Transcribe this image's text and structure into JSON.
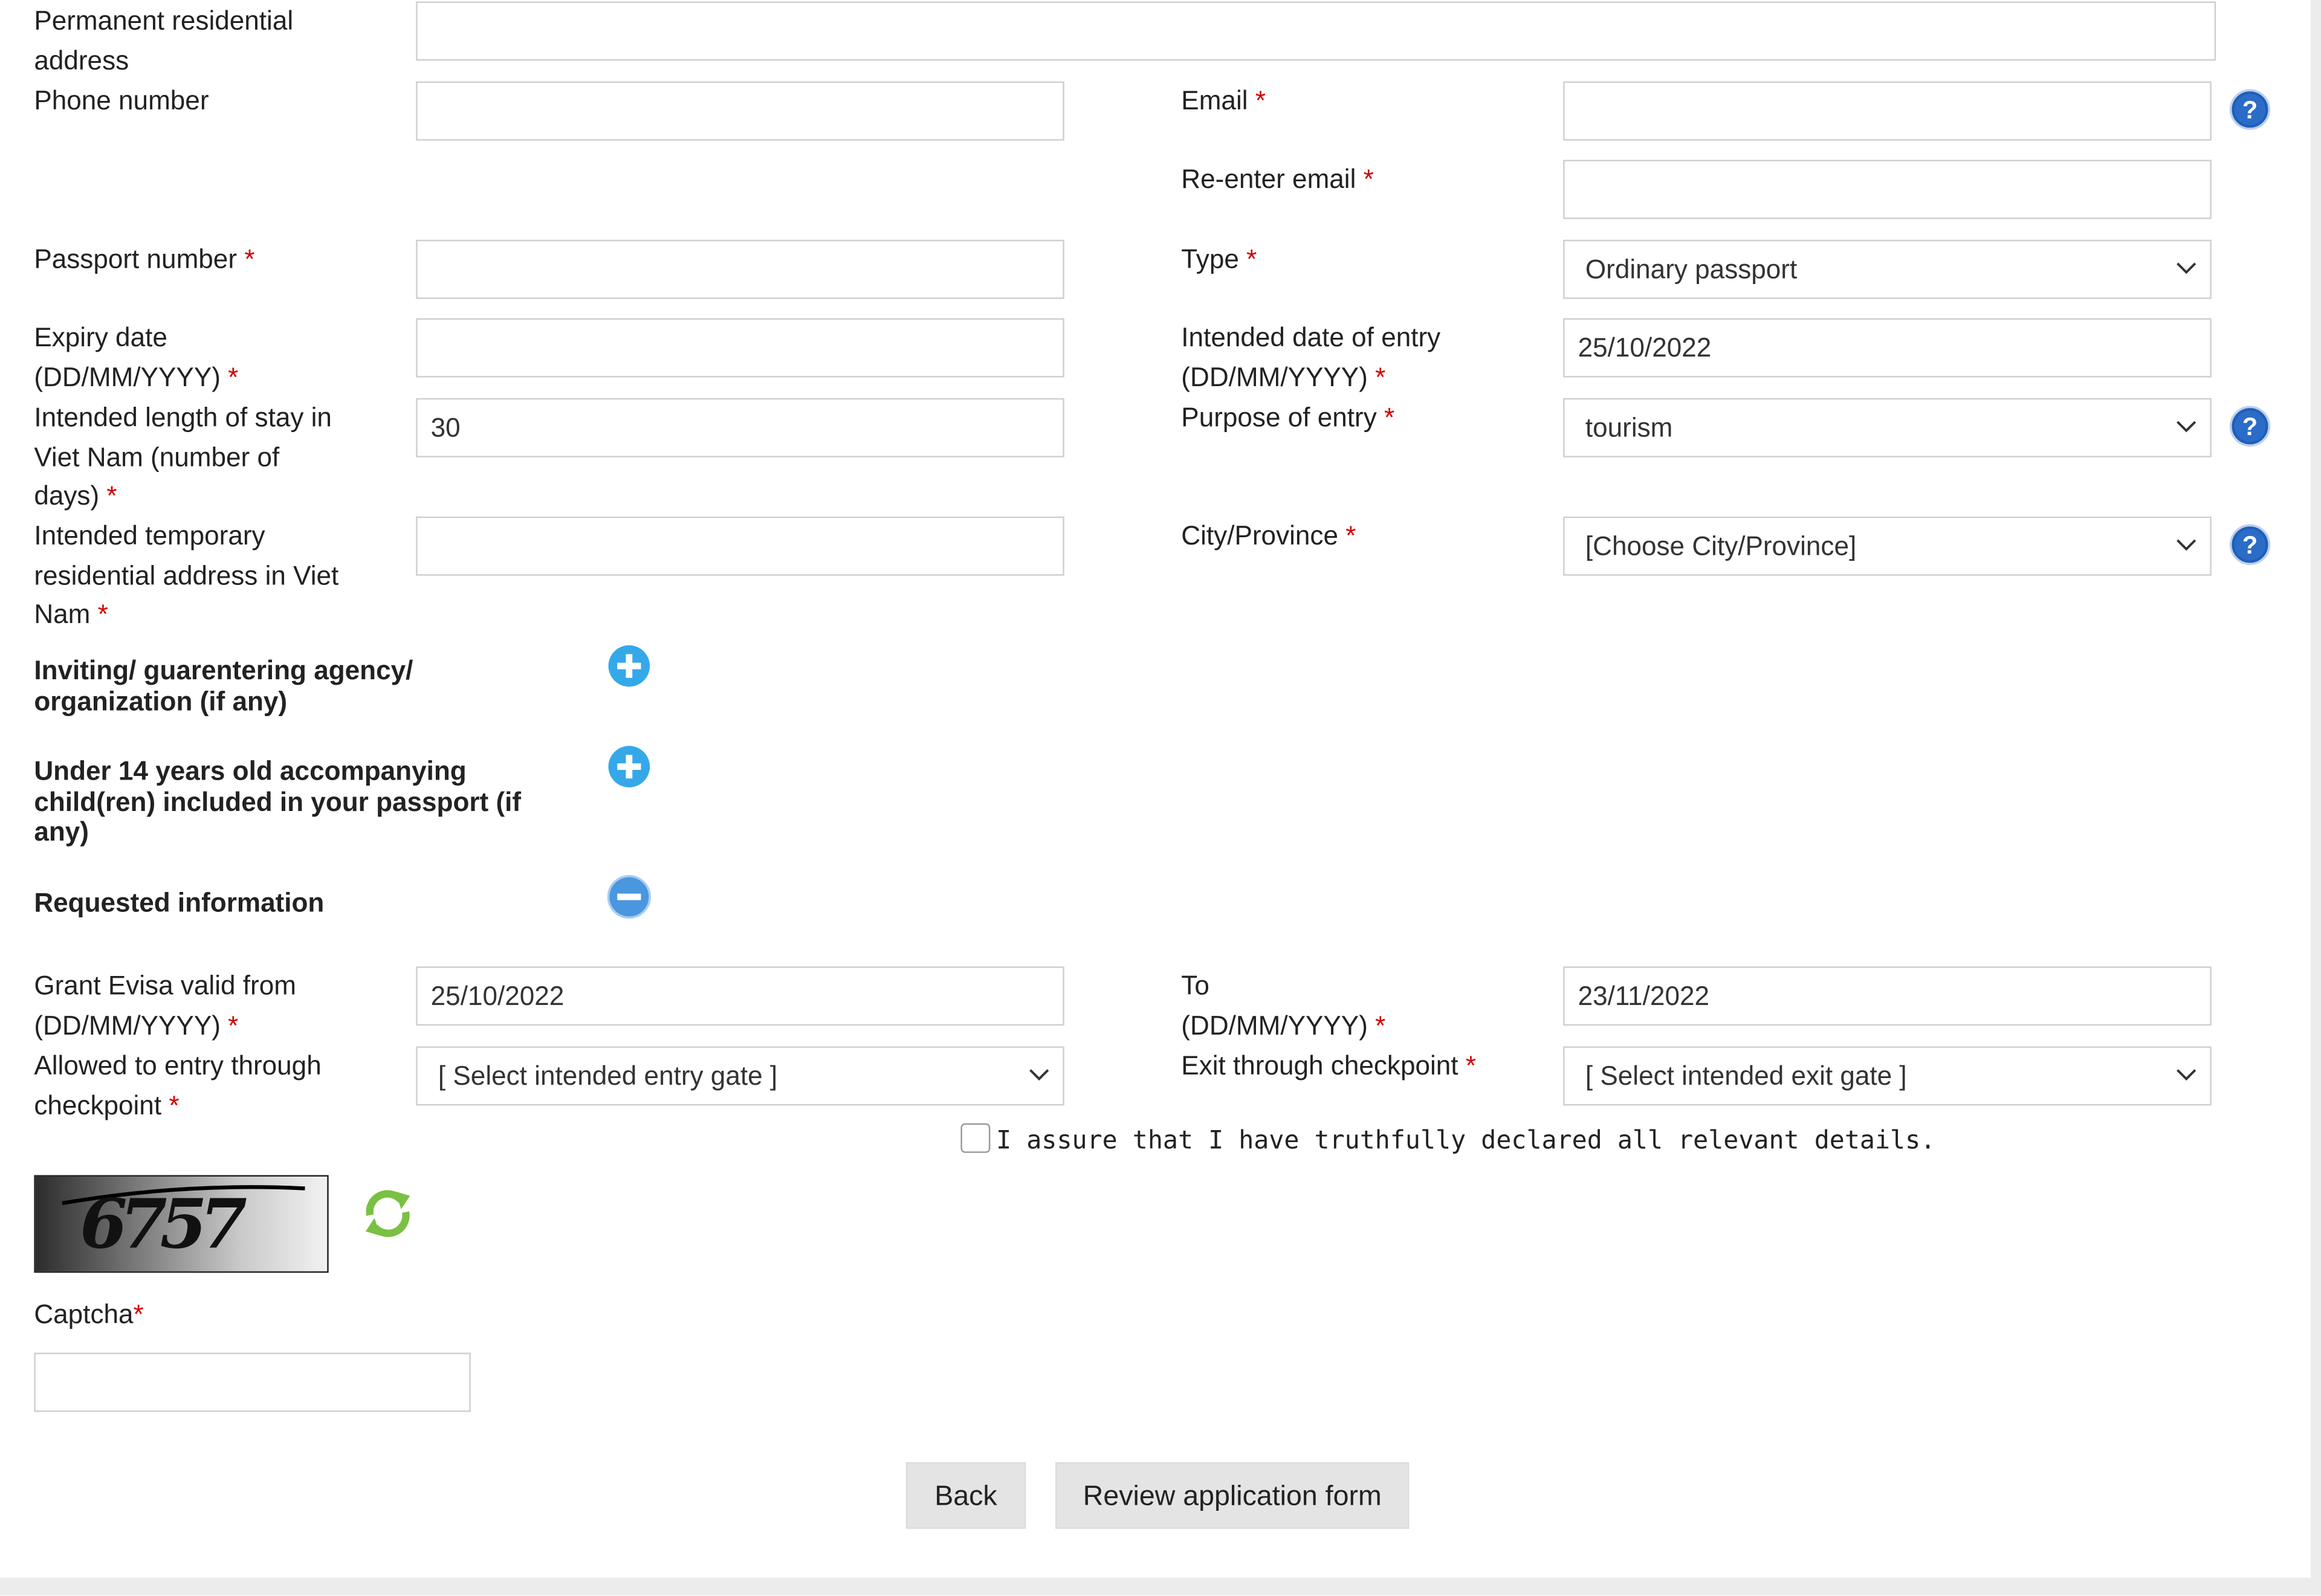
{
  "form": {
    "permanent_address": {
      "label_line1": "Permanent residential",
      "label_line2": "address",
      "value": ""
    },
    "phone": {
      "label": "Phone number",
      "value": ""
    },
    "email": {
      "label": "Email",
      "required": "*",
      "value": ""
    },
    "reenter_email": {
      "label": "Re-enter email",
      "required": "*",
      "value": ""
    },
    "passport_number": {
      "label": "Passport number",
      "required": "*",
      "value": ""
    },
    "passport_type": {
      "label": "Type",
      "required": "*",
      "value": "Ordinary passport"
    },
    "expiry_date": {
      "label_line1": "Expiry date",
      "label_line2": "(DD/MM/YYYY)",
      "required": "*",
      "value": ""
    },
    "entry_date": {
      "label_line1": "Intended date of entry",
      "label_line2": "(DD/MM/YYYY)",
      "required": "*",
      "value": "25/10/2022"
    },
    "length_of_stay": {
      "label_line1": "Intended length of stay in",
      "label_line2": "Viet Nam (number of",
      "label_line3": "days)",
      "required": "*",
      "value": "30"
    },
    "purpose": {
      "label": "Purpose of entry",
      "required": "*",
      "value": "tourism"
    },
    "temp_address": {
      "label_line1": "Intended temporary",
      "label_line2": "residential address in Viet",
      "label_line3": "Nam",
      "required": "*",
      "value": ""
    },
    "city": {
      "label": "City/Province",
      "required": "*",
      "value": "[Choose City/Province]"
    }
  },
  "sections": {
    "inviting_line1": "Inviting/ guarentering agency/",
    "inviting_line2": "organization (if any)",
    "children_line1": "Under 14 years old accompanying",
    "children_line2": "child(ren) included in your passport (if",
    "children_line3": "any)",
    "requested": "Requested information"
  },
  "requested": {
    "valid_from": {
      "label_line1": "Grant Evisa valid from",
      "label_line2": "(DD/MM/YYYY)",
      "required": "*",
      "value": "25/10/2022"
    },
    "valid_to": {
      "label_line1": "To",
      "label_line2": "(DD/MM/YYYY)",
      "required": "*",
      "value": "23/11/2022"
    },
    "entry_gate": {
      "label_line1": "Allowed to entry through",
      "label_line2": "checkpoint",
      "required": "*",
      "value": "[ Select intended entry gate ]"
    },
    "exit_gate": {
      "label": "Exit through checkpoint",
      "required": "*",
      "value": "[ Select intended exit gate ]"
    }
  },
  "declaration": {
    "text": "I assure that I have truthfully declared all relevant details.",
    "checked": false
  },
  "captcha": {
    "image_text": "6757",
    "label": "Captcha",
    "required": "*",
    "value": ""
  },
  "buttons": {
    "back": "Back",
    "review": "Review application form"
  },
  "icons": {
    "help": "question-circle-icon",
    "expand": "plus-circle-icon",
    "collapse": "minus-circle-icon",
    "refresh": "refresh-icon",
    "dropdown": "chevron-down-icon"
  },
  "colors": {
    "required": "#d00000",
    "help_blue": "#1f5fb8",
    "expand_blue": "#35a8ea",
    "refresh_green": "#7ac043"
  }
}
